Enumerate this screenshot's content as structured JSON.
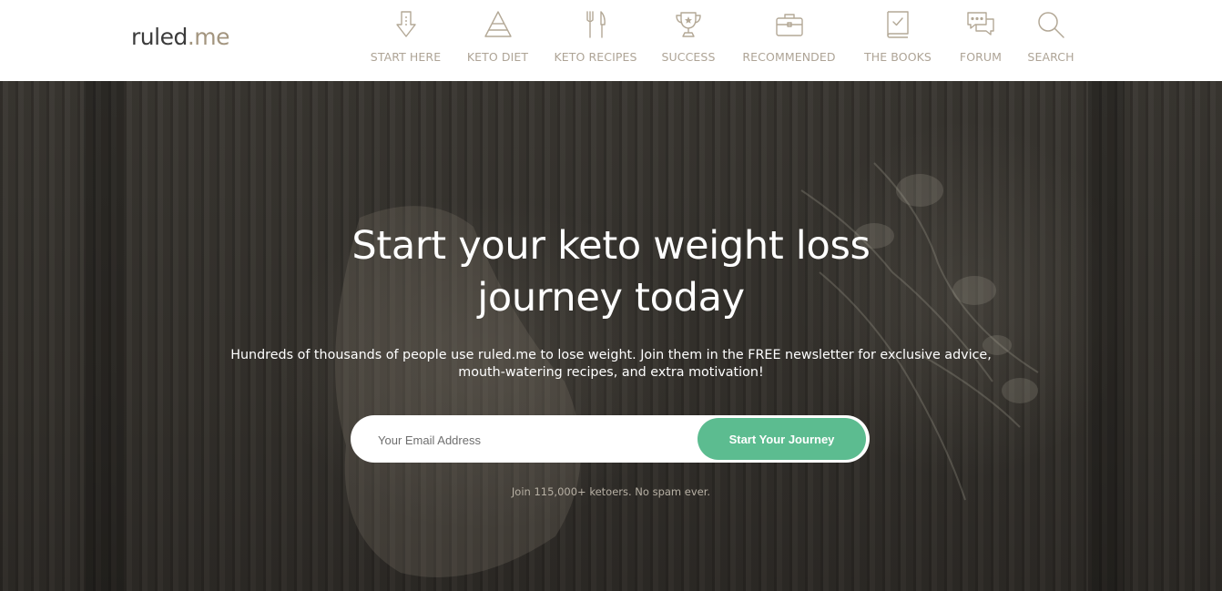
{
  "brand": {
    "name_part1": "ruled",
    "name_part2": ".me"
  },
  "nav": {
    "items": [
      {
        "label": "START HERE",
        "icon": "arrow-down-icon"
      },
      {
        "label": "KETO DIET",
        "icon": "pyramid-icon"
      },
      {
        "label": "KETO RECIPES",
        "icon": "fork-knife-icon"
      },
      {
        "label": "SUCCESS",
        "icon": "trophy-icon"
      },
      {
        "label": "RECOMMENDED",
        "icon": "briefcase-icon"
      },
      {
        "label": "THE BOOKS",
        "icon": "book-icon"
      },
      {
        "label": "FORUM",
        "icon": "chat-bubbles-icon"
      },
      {
        "label": "SEARCH",
        "icon": "search-icon"
      }
    ]
  },
  "hero": {
    "title_line1": "Start your keto weight loss",
    "title_line2": "journey today",
    "subtitle_line1": "Hundreds of thousands of people use ruled.me to lose weight. Join them in the FREE newsletter for exclusive advice,",
    "subtitle_line2": "mouth-watering recipes, and extra motivation!",
    "email_placeholder": "Your Email Address",
    "cta_label": "Start Your Journey",
    "note": "Join 115,000+ ketoers. No spam ever."
  },
  "colors": {
    "accent_green": "#5cbc90",
    "nav_label": "#aea496",
    "logo_dark": "#3b3b3b",
    "logo_tan": "#a3957f"
  }
}
